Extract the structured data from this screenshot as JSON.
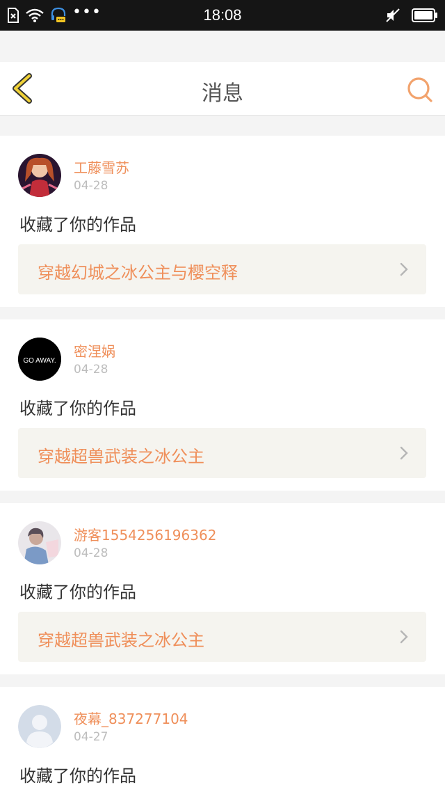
{
  "status_bar": {
    "time": "18:08",
    "left_icons": [
      "sim-error-icon",
      "wifi-icon",
      "headset-chat-icon",
      "more-dots-icon"
    ],
    "right_icons": [
      "mute-icon",
      "battery-icon"
    ],
    "dots": "•••"
  },
  "header": {
    "title": "消息",
    "back_icon": "back-chevron-icon",
    "search_icon": "search-icon"
  },
  "messages": [
    {
      "username": "工藤雪苏",
      "date": "04-28",
      "action": "收藏了你的作品",
      "work_title": "穿越幻城之冰公主与樱空释"
    },
    {
      "username": "密涅娲",
      "date": "04-28",
      "action": "收藏了你的作品",
      "work_title": "穿越超兽武装之冰公主",
      "avatar_text": "GO AWAY."
    },
    {
      "username": "游客1554256196362",
      "date": "04-28",
      "action": "收藏了你的作品",
      "work_title": "穿越超兽武装之冰公主"
    },
    {
      "username": "夜幕_837277104",
      "date": "04-27",
      "action": "收藏了你的作品"
    }
  ],
  "colors": {
    "accent": "#ef8f5a",
    "back_icon": "#e8c225",
    "status_bar": "#151515",
    "link_bg": "#f5f4ef"
  }
}
